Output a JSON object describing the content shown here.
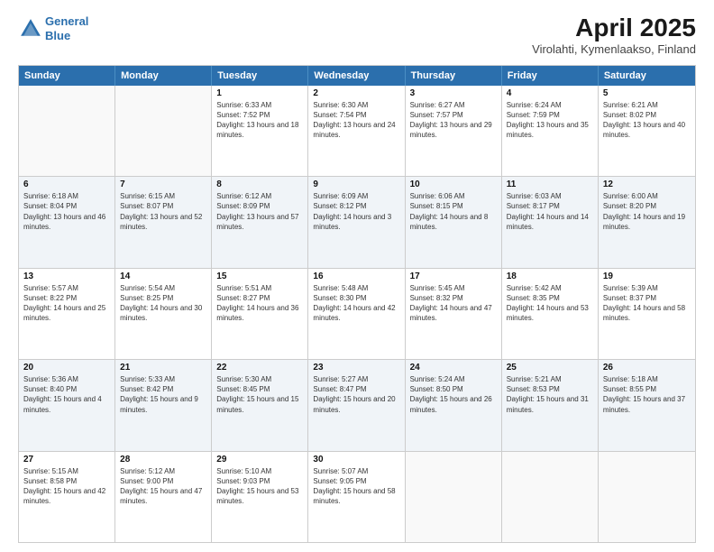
{
  "header": {
    "logo_line1": "General",
    "logo_line2": "Blue",
    "title": "April 2025",
    "subtitle": "Virolahti, Kymenlaakso, Finland"
  },
  "calendar": {
    "days_of_week": [
      "Sunday",
      "Monday",
      "Tuesday",
      "Wednesday",
      "Thursday",
      "Friday",
      "Saturday"
    ],
    "rows": [
      [
        {
          "day": "",
          "info": ""
        },
        {
          "day": "",
          "info": ""
        },
        {
          "day": "1",
          "info": "Sunrise: 6:33 AM\nSunset: 7:52 PM\nDaylight: 13 hours and 18 minutes."
        },
        {
          "day": "2",
          "info": "Sunrise: 6:30 AM\nSunset: 7:54 PM\nDaylight: 13 hours and 24 minutes."
        },
        {
          "day": "3",
          "info": "Sunrise: 6:27 AM\nSunset: 7:57 PM\nDaylight: 13 hours and 29 minutes."
        },
        {
          "day": "4",
          "info": "Sunrise: 6:24 AM\nSunset: 7:59 PM\nDaylight: 13 hours and 35 minutes."
        },
        {
          "day": "5",
          "info": "Sunrise: 6:21 AM\nSunset: 8:02 PM\nDaylight: 13 hours and 40 minutes."
        }
      ],
      [
        {
          "day": "6",
          "info": "Sunrise: 6:18 AM\nSunset: 8:04 PM\nDaylight: 13 hours and 46 minutes."
        },
        {
          "day": "7",
          "info": "Sunrise: 6:15 AM\nSunset: 8:07 PM\nDaylight: 13 hours and 52 minutes."
        },
        {
          "day": "8",
          "info": "Sunrise: 6:12 AM\nSunset: 8:09 PM\nDaylight: 13 hours and 57 minutes."
        },
        {
          "day": "9",
          "info": "Sunrise: 6:09 AM\nSunset: 8:12 PM\nDaylight: 14 hours and 3 minutes."
        },
        {
          "day": "10",
          "info": "Sunrise: 6:06 AM\nSunset: 8:15 PM\nDaylight: 14 hours and 8 minutes."
        },
        {
          "day": "11",
          "info": "Sunrise: 6:03 AM\nSunset: 8:17 PM\nDaylight: 14 hours and 14 minutes."
        },
        {
          "day": "12",
          "info": "Sunrise: 6:00 AM\nSunset: 8:20 PM\nDaylight: 14 hours and 19 minutes."
        }
      ],
      [
        {
          "day": "13",
          "info": "Sunrise: 5:57 AM\nSunset: 8:22 PM\nDaylight: 14 hours and 25 minutes."
        },
        {
          "day": "14",
          "info": "Sunrise: 5:54 AM\nSunset: 8:25 PM\nDaylight: 14 hours and 30 minutes."
        },
        {
          "day": "15",
          "info": "Sunrise: 5:51 AM\nSunset: 8:27 PM\nDaylight: 14 hours and 36 minutes."
        },
        {
          "day": "16",
          "info": "Sunrise: 5:48 AM\nSunset: 8:30 PM\nDaylight: 14 hours and 42 minutes."
        },
        {
          "day": "17",
          "info": "Sunrise: 5:45 AM\nSunset: 8:32 PM\nDaylight: 14 hours and 47 minutes."
        },
        {
          "day": "18",
          "info": "Sunrise: 5:42 AM\nSunset: 8:35 PM\nDaylight: 14 hours and 53 minutes."
        },
        {
          "day": "19",
          "info": "Sunrise: 5:39 AM\nSunset: 8:37 PM\nDaylight: 14 hours and 58 minutes."
        }
      ],
      [
        {
          "day": "20",
          "info": "Sunrise: 5:36 AM\nSunset: 8:40 PM\nDaylight: 15 hours and 4 minutes."
        },
        {
          "day": "21",
          "info": "Sunrise: 5:33 AM\nSunset: 8:42 PM\nDaylight: 15 hours and 9 minutes."
        },
        {
          "day": "22",
          "info": "Sunrise: 5:30 AM\nSunset: 8:45 PM\nDaylight: 15 hours and 15 minutes."
        },
        {
          "day": "23",
          "info": "Sunrise: 5:27 AM\nSunset: 8:47 PM\nDaylight: 15 hours and 20 minutes."
        },
        {
          "day": "24",
          "info": "Sunrise: 5:24 AM\nSunset: 8:50 PM\nDaylight: 15 hours and 26 minutes."
        },
        {
          "day": "25",
          "info": "Sunrise: 5:21 AM\nSunset: 8:53 PM\nDaylight: 15 hours and 31 minutes."
        },
        {
          "day": "26",
          "info": "Sunrise: 5:18 AM\nSunset: 8:55 PM\nDaylight: 15 hours and 37 minutes."
        }
      ],
      [
        {
          "day": "27",
          "info": "Sunrise: 5:15 AM\nSunset: 8:58 PM\nDaylight: 15 hours and 42 minutes."
        },
        {
          "day": "28",
          "info": "Sunrise: 5:12 AM\nSunset: 9:00 PM\nDaylight: 15 hours and 47 minutes."
        },
        {
          "day": "29",
          "info": "Sunrise: 5:10 AM\nSunset: 9:03 PM\nDaylight: 15 hours and 53 minutes."
        },
        {
          "day": "30",
          "info": "Sunrise: 5:07 AM\nSunset: 9:05 PM\nDaylight: 15 hours and 58 minutes."
        },
        {
          "day": "",
          "info": ""
        },
        {
          "day": "",
          "info": ""
        },
        {
          "day": "",
          "info": ""
        }
      ]
    ]
  }
}
